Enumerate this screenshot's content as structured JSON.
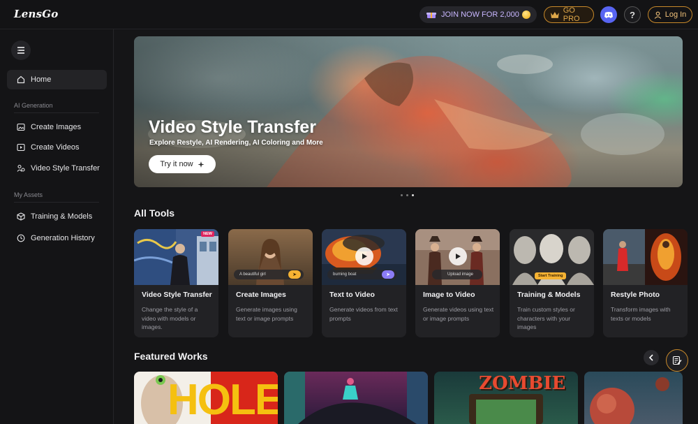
{
  "app": {
    "logo": "LensGo"
  },
  "header": {
    "join_label": "JOIN NOW FOR 2,000",
    "gopro_label": "GO PRO",
    "help_glyph": "?",
    "login_label": "Log In"
  },
  "sidebar": {
    "home_label": "Home",
    "section_ai": "AI Generation",
    "create_images": "Create Images",
    "create_videos": "Create Videos",
    "video_style_transfer": "Video Style Transfer",
    "section_assets": "My Assets",
    "training_models": "Training & Models",
    "generation_history": "Generation History"
  },
  "hero": {
    "title": "Video Style Transfer",
    "subtitle": "Explore Restyle, AI Rendering, AI Coloring and More",
    "cta_label": "Try it now"
  },
  "all_tools": {
    "title": "All Tools",
    "tools": [
      {
        "name": "Video Style Transfer",
        "desc": "Change the style of a video with models or images.",
        "badge": "NEW"
      },
      {
        "name": "Create Images",
        "desc": "Generate images using text or image prompts",
        "overlay": "A beautiful girl"
      },
      {
        "name": "Text to Video",
        "desc": "Generate videos from text prompts",
        "overlay": "burning boat"
      },
      {
        "name": "Image to Video",
        "desc": "Generate videos using text or image prompts",
        "overlay": "Upload image"
      },
      {
        "name": "Training & Models",
        "desc": "Train custom styles or characters with your images",
        "overlay": "Start Training"
      },
      {
        "name": "Restyle Photo",
        "desc": "Transform images with texts or models"
      }
    ]
  },
  "featured": {
    "title": "Featured Works",
    "card1_text": "HOLE",
    "card3_text": "ZOMBIE"
  },
  "colors": {
    "accent_gold": "#c8892a",
    "discord": "#5865f2",
    "new_badge": "#e0245e"
  }
}
